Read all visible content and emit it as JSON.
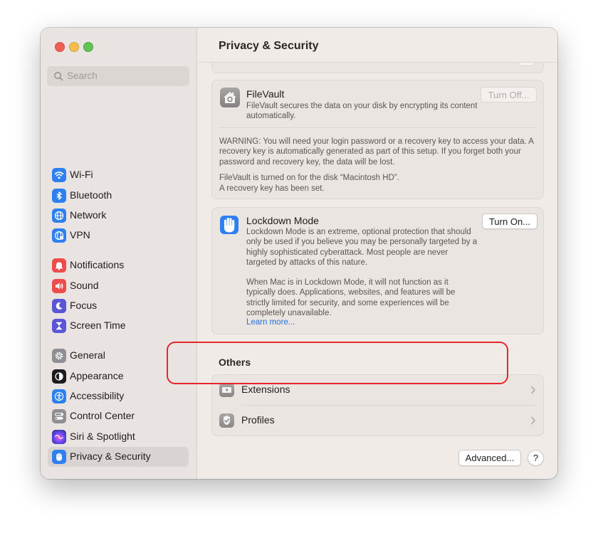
{
  "sidebar": {
    "search_placeholder": "Search",
    "items": [
      {
        "label": "Wi-Fi",
        "icon": "wifi-icon",
        "color": "#2e80f1"
      },
      {
        "label": "Bluetooth",
        "icon": "bluetooth-icon",
        "color": "#2e80f1"
      },
      {
        "label": "Network",
        "icon": "network-globe-icon",
        "color": "#2e80f1"
      },
      {
        "label": "VPN",
        "icon": "vpn-globe-icon",
        "color": "#2e80f1"
      },
      {
        "label": "Notifications",
        "icon": "notifications-bell-icon",
        "color": "#ec4c4a"
      },
      {
        "label": "Sound",
        "icon": "sound-speaker-icon",
        "color": "#ec4c4a"
      },
      {
        "label": "Focus",
        "icon": "focus-moon-icon",
        "color": "#5b56d6"
      },
      {
        "label": "Screen Time",
        "icon": "screen-time-hourglass-icon",
        "color": "#5b56d6"
      },
      {
        "label": "General",
        "icon": "general-gear-icon",
        "color": "#8e8e93"
      },
      {
        "label": "Appearance",
        "icon": "appearance-icon",
        "color": "#1c1c1e"
      },
      {
        "label": "Accessibility",
        "icon": "accessibility-icon",
        "color": "#2e80f1"
      },
      {
        "label": "Control Center",
        "icon": "control-center-icon",
        "color": "#8e8e93"
      },
      {
        "label": "Siri & Spotlight",
        "icon": "siri-icon",
        "color": "#3a3a6e"
      },
      {
        "label": "Privacy & Security",
        "icon": "privacy-hand-icon",
        "color": "#2e80f1",
        "selected": true
      }
    ]
  },
  "main": {
    "title": "Privacy & Security",
    "filevault": {
      "title": "FileVault",
      "desc": "FileVault secures the data on your disk by encrypting its content automatically.",
      "button": "Turn Off...",
      "warning": "WARNING: You will need your login password or a recovery key to access your data. A recovery key is automatically generated as part of this setup. If you forget both your password and recovery key, the data will be lost.",
      "status_line1": "FileVault is turned on for the disk “Macintosh HD”.",
      "status_line2": "A recovery key has been set."
    },
    "lockdown": {
      "title": "Lockdown Mode",
      "desc": "Lockdown Mode is an extreme, optional protection that should only be used if you believe you may be personally targeted by a highly sophisticated cyberattack. Most people are never targeted by attacks of this nature.",
      "desc2": "When Mac is in Lockdown Mode, it will not function as it typically does. Applications, websites, and features will be strictly limited for security, and some experiences will be completely unavailable.",
      "link": "Learn more...",
      "button": "Turn On..."
    },
    "others": {
      "heading": "Others",
      "rows": [
        {
          "label": "Extensions",
          "icon": "extensions-icon"
        },
        {
          "label": "Profiles",
          "icon": "profiles-check-icon"
        }
      ]
    },
    "advanced_button": "Advanced...",
    "help_button": "?"
  },
  "colors": {
    "accent": "#2e80f1",
    "highlight": "#e8242a",
    "link": "#2a6fd6"
  }
}
